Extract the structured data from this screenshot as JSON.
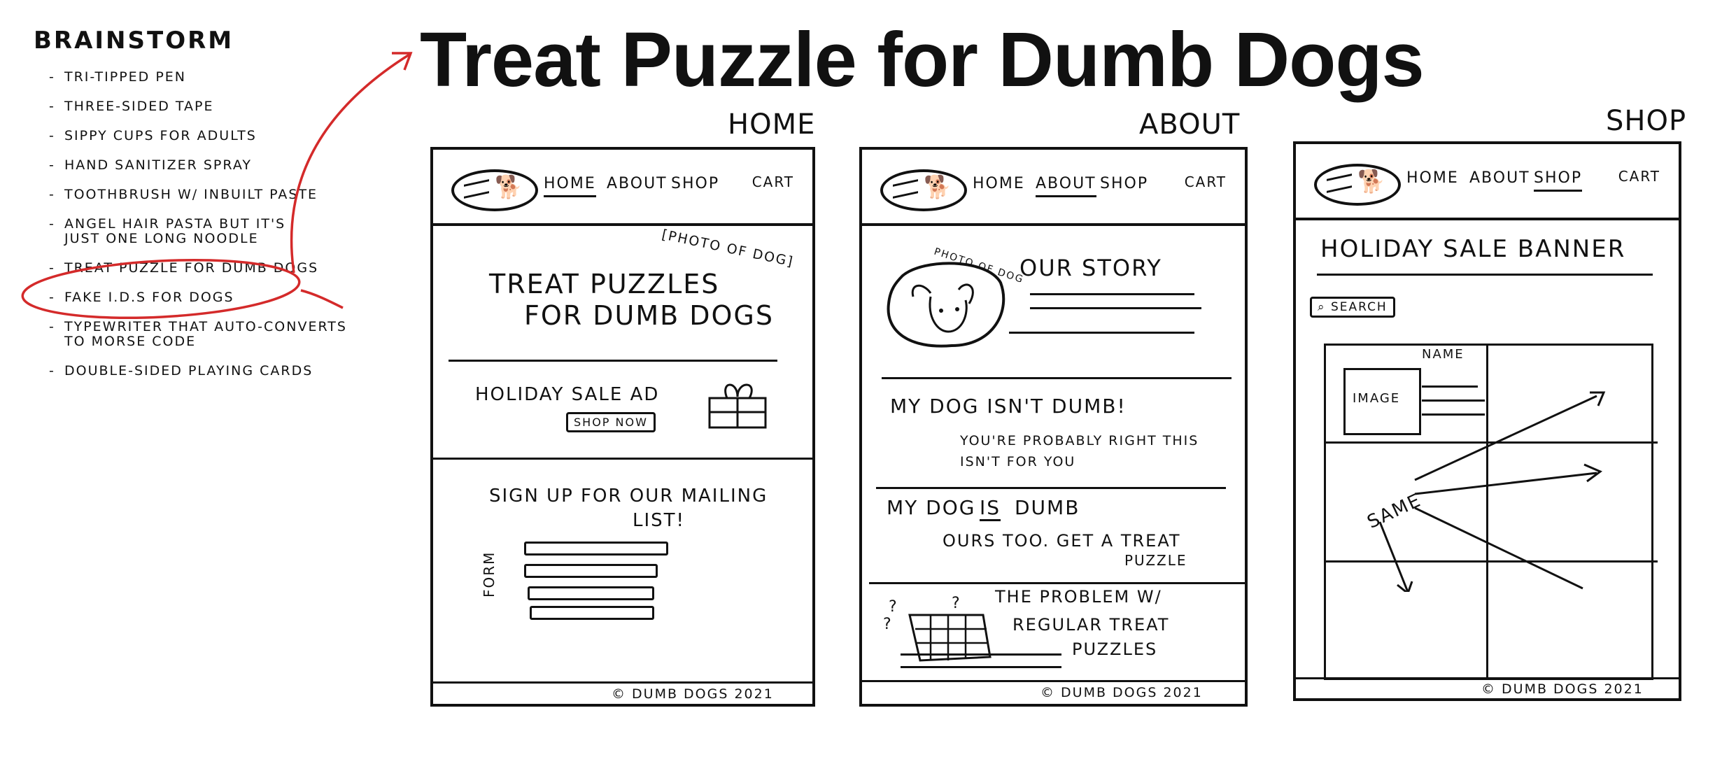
{
  "title": "Treat Puzzle for Dumb Dogs",
  "brainstorm": {
    "heading": "Brainstorm",
    "items": [
      "Tri-tipped pen",
      "Three-sided tape",
      "Sippy cups for adults",
      "Hand sanitizer spray",
      "Toothbrush w/ inbuilt paste",
      "Angel hair pasta but it's\njust one long noodle",
      "Treat puzzle for dumb dogs",
      "Fake I.D.s for dogs",
      "Typewriter that auto-converts\nto morse code",
      "Double-sided playing cards"
    ]
  },
  "nav": {
    "home": "Home",
    "about": "About",
    "shop": "Shop",
    "cart": "Cart"
  },
  "footer": "© Dumb Dogs 2021",
  "home": {
    "label": "Home",
    "photo_note": "[Photo of dog]",
    "hero_line1": "Treat puzzles",
    "hero_line2": "for dumb dogs",
    "ad": "Holiday sale ad",
    "shop_now": "Shop now",
    "signup_line1": "Sign up for our mailing",
    "signup_line2": "list!",
    "form_label": "Form"
  },
  "about": {
    "label": "About",
    "photo_label": "Photo of dog",
    "story": "Our story",
    "h1": "My dog isn't dumb!",
    "p1_line1": "You're probably right this",
    "p1_line2": "isn't for you",
    "h2_a": "My dog",
    "h2_b": "is",
    "h2_c": "dumb",
    "p2_line1": "Ours too. Get a treat",
    "p2_line2": "puzzle",
    "problem_line1": "The problem w/",
    "problem_line2": "regular treat",
    "problem_line3": "puzzles"
  },
  "shop": {
    "label": "Shop",
    "banner": "Holiday sale banner",
    "search": "Search",
    "image": "Image",
    "name": "Name",
    "same": "Same"
  },
  "colors": {
    "ink": "#111111",
    "annotation": "#d42a2a",
    "background": "#ffffff"
  }
}
